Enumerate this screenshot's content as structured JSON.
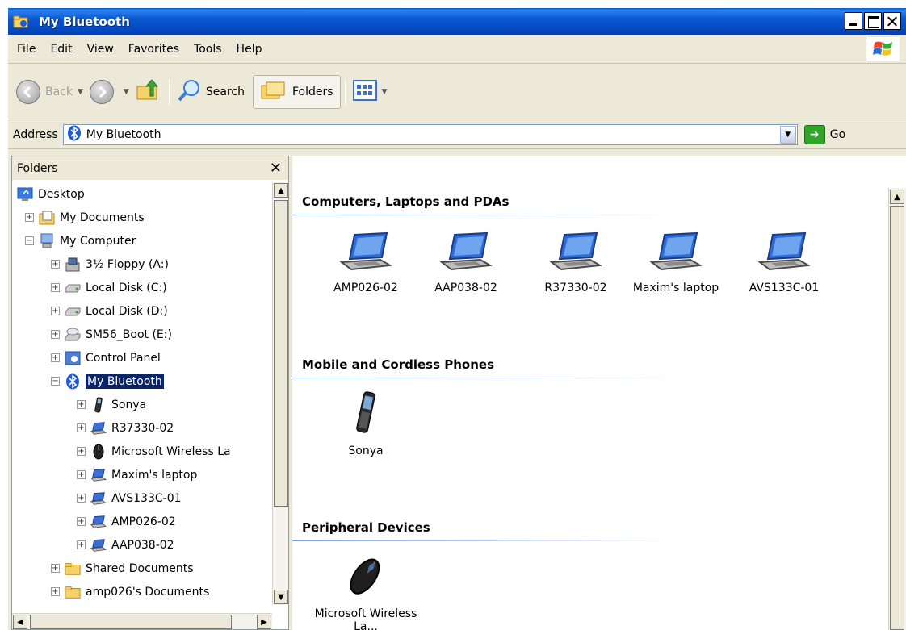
{
  "window": {
    "title": "My Bluetooth"
  },
  "menubar": {
    "items": [
      "File",
      "Edit",
      "View",
      "Favorites",
      "Tools",
      "Help"
    ],
    "mnemonics": [
      "F",
      "E",
      "V",
      "a",
      "T",
      "H"
    ]
  },
  "toolbar": {
    "back_label": "Back",
    "search_label": "Search",
    "folders_label": "Folders"
  },
  "address": {
    "label": "Address",
    "value": "My Bluetooth",
    "go_label": "Go"
  },
  "folders_pane": {
    "header": "Folders",
    "close_glyph": "✕",
    "tree": [
      {
        "label": "Desktop",
        "level": 0,
        "expander": "",
        "icon": "desktop-icon"
      },
      {
        "label": "My Documents",
        "level": 1,
        "expander": "+",
        "icon": "my-documents-icon"
      },
      {
        "label": "My Computer",
        "level": 1,
        "expander": "−",
        "icon": "my-computer-icon"
      },
      {
        "label": "3½ Floppy (A:)",
        "level": 2,
        "expander": "+",
        "icon": "floppy-icon"
      },
      {
        "label": "Local Disk (C:)",
        "level": 2,
        "expander": "+",
        "icon": "disk-icon"
      },
      {
        "label": "Local Disk (D:)",
        "level": 2,
        "expander": "+",
        "icon": "disk-icon"
      },
      {
        "label": "SM56_Boot (E:)",
        "level": 2,
        "expander": "+",
        "icon": "cd-drive-icon"
      },
      {
        "label": "Control Panel",
        "level": 2,
        "expander": "+",
        "icon": "control-panel-icon"
      },
      {
        "label": "My Bluetooth",
        "level": 2,
        "expander": "−",
        "icon": "bluetooth-icon",
        "selected": true
      },
      {
        "label": "Sonya",
        "level": 3,
        "expander": "+",
        "icon": "phone-icon"
      },
      {
        "label": "R37330-02",
        "level": 3,
        "expander": "+",
        "icon": "laptop-icon"
      },
      {
        "label": "Microsoft Wireless La",
        "level": 3,
        "expander": "+",
        "icon": "mouse-icon"
      },
      {
        "label": "Maxim's laptop",
        "level": 3,
        "expander": "+",
        "icon": "laptop-icon"
      },
      {
        "label": "AVS133C-01",
        "level": 3,
        "expander": "+",
        "icon": "laptop-icon"
      },
      {
        "label": "AMP026-02",
        "level": 3,
        "expander": "+",
        "icon": "laptop-icon"
      },
      {
        "label": "AAP038-02",
        "level": 3,
        "expander": "+",
        "icon": "laptop-icon"
      },
      {
        "label": "Shared Documents",
        "level": 2,
        "expander": "+",
        "icon": "folder-icon"
      },
      {
        "label": "amp026's Documents",
        "level": 2,
        "expander": "+",
        "icon": "folder-icon"
      }
    ]
  },
  "content": {
    "groups": [
      {
        "title": "Computers, Laptops and PDAs",
        "devices": [
          {
            "label": "AMP026-02",
            "icon": "laptop-icon"
          },
          {
            "label": "AAP038-02",
            "icon": "laptop-icon"
          },
          {
            "label": "R37330-02",
            "icon": "laptop-icon"
          },
          {
            "label": "Maxim's laptop",
            "icon": "laptop-icon"
          },
          {
            "label": "AVS133C-01",
            "icon": "laptop-icon"
          }
        ]
      },
      {
        "title": "Mobile and Cordless Phones",
        "devices": [
          {
            "label": "Sonya",
            "icon": "phone-icon"
          }
        ]
      },
      {
        "title": "Peripheral Devices",
        "devices": [
          {
            "label": "Microsoft Wireless La...",
            "icon": "mouse-icon"
          }
        ]
      }
    ]
  }
}
